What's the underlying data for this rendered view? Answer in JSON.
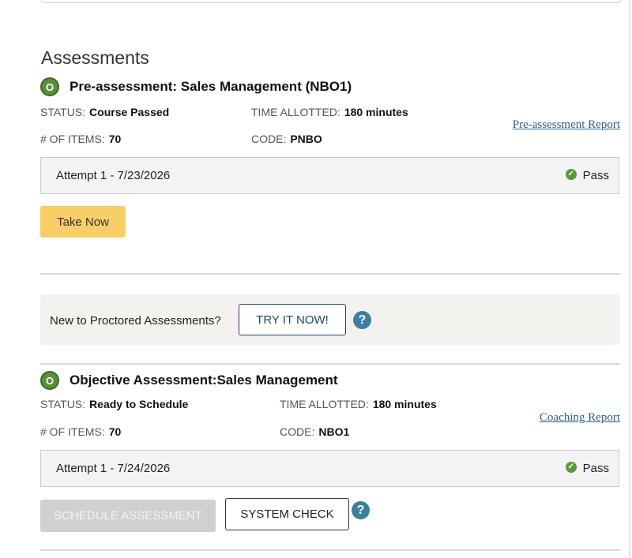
{
  "section_title": "Assessments",
  "pre_assessment": {
    "icon_letter": "O",
    "title": "Pre-assessment: Sales Management (NBO1)",
    "status_label": "STATUS:",
    "status_value": "Course Passed",
    "time_label": "TIME ALLOTTED:",
    "time_value": "180 minutes",
    "items_label": "# OF ITEMS:",
    "items_value": "70",
    "code_label": "CODE:",
    "code_value": "PNBO",
    "report_link": "Pre-assessment Report",
    "attempt_label": "Attempt 1 - 7/23/2026",
    "attempt_result": "Pass",
    "take_now_button": "Take Now"
  },
  "proctored": {
    "prompt": "New to Proctored Assessments?",
    "try_button": "TRY IT NOW!",
    "help_icon": "?"
  },
  "objective_assessment": {
    "icon_letter": "O",
    "title": "Objective Assessment:Sales Management",
    "status_label": "STATUS:",
    "status_value": "Ready to Schedule",
    "time_label": "TIME ALLOTTED:",
    "time_value": "180 minutes",
    "items_label": "# OF ITEMS:",
    "items_value": "70",
    "code_label": "CODE:",
    "code_value": "NBO1",
    "report_link": "Coaching Report",
    "attempt_label": "Attempt 1 - 7/24/2026",
    "attempt_result": "Pass",
    "schedule_button": "SCHEDULE ASSESSMENT",
    "system_check_button": "SYSTEM CHECK",
    "help_icon": "?"
  },
  "icons": {
    "check": "✓"
  },
  "colors": {
    "status_green": "#5a8f3a",
    "take_now_yellow": "#f8cf67",
    "link_blue": "#2a5f8f",
    "help_blue": "#3c7fa1",
    "proctor_bg": "#f4f2ee"
  }
}
